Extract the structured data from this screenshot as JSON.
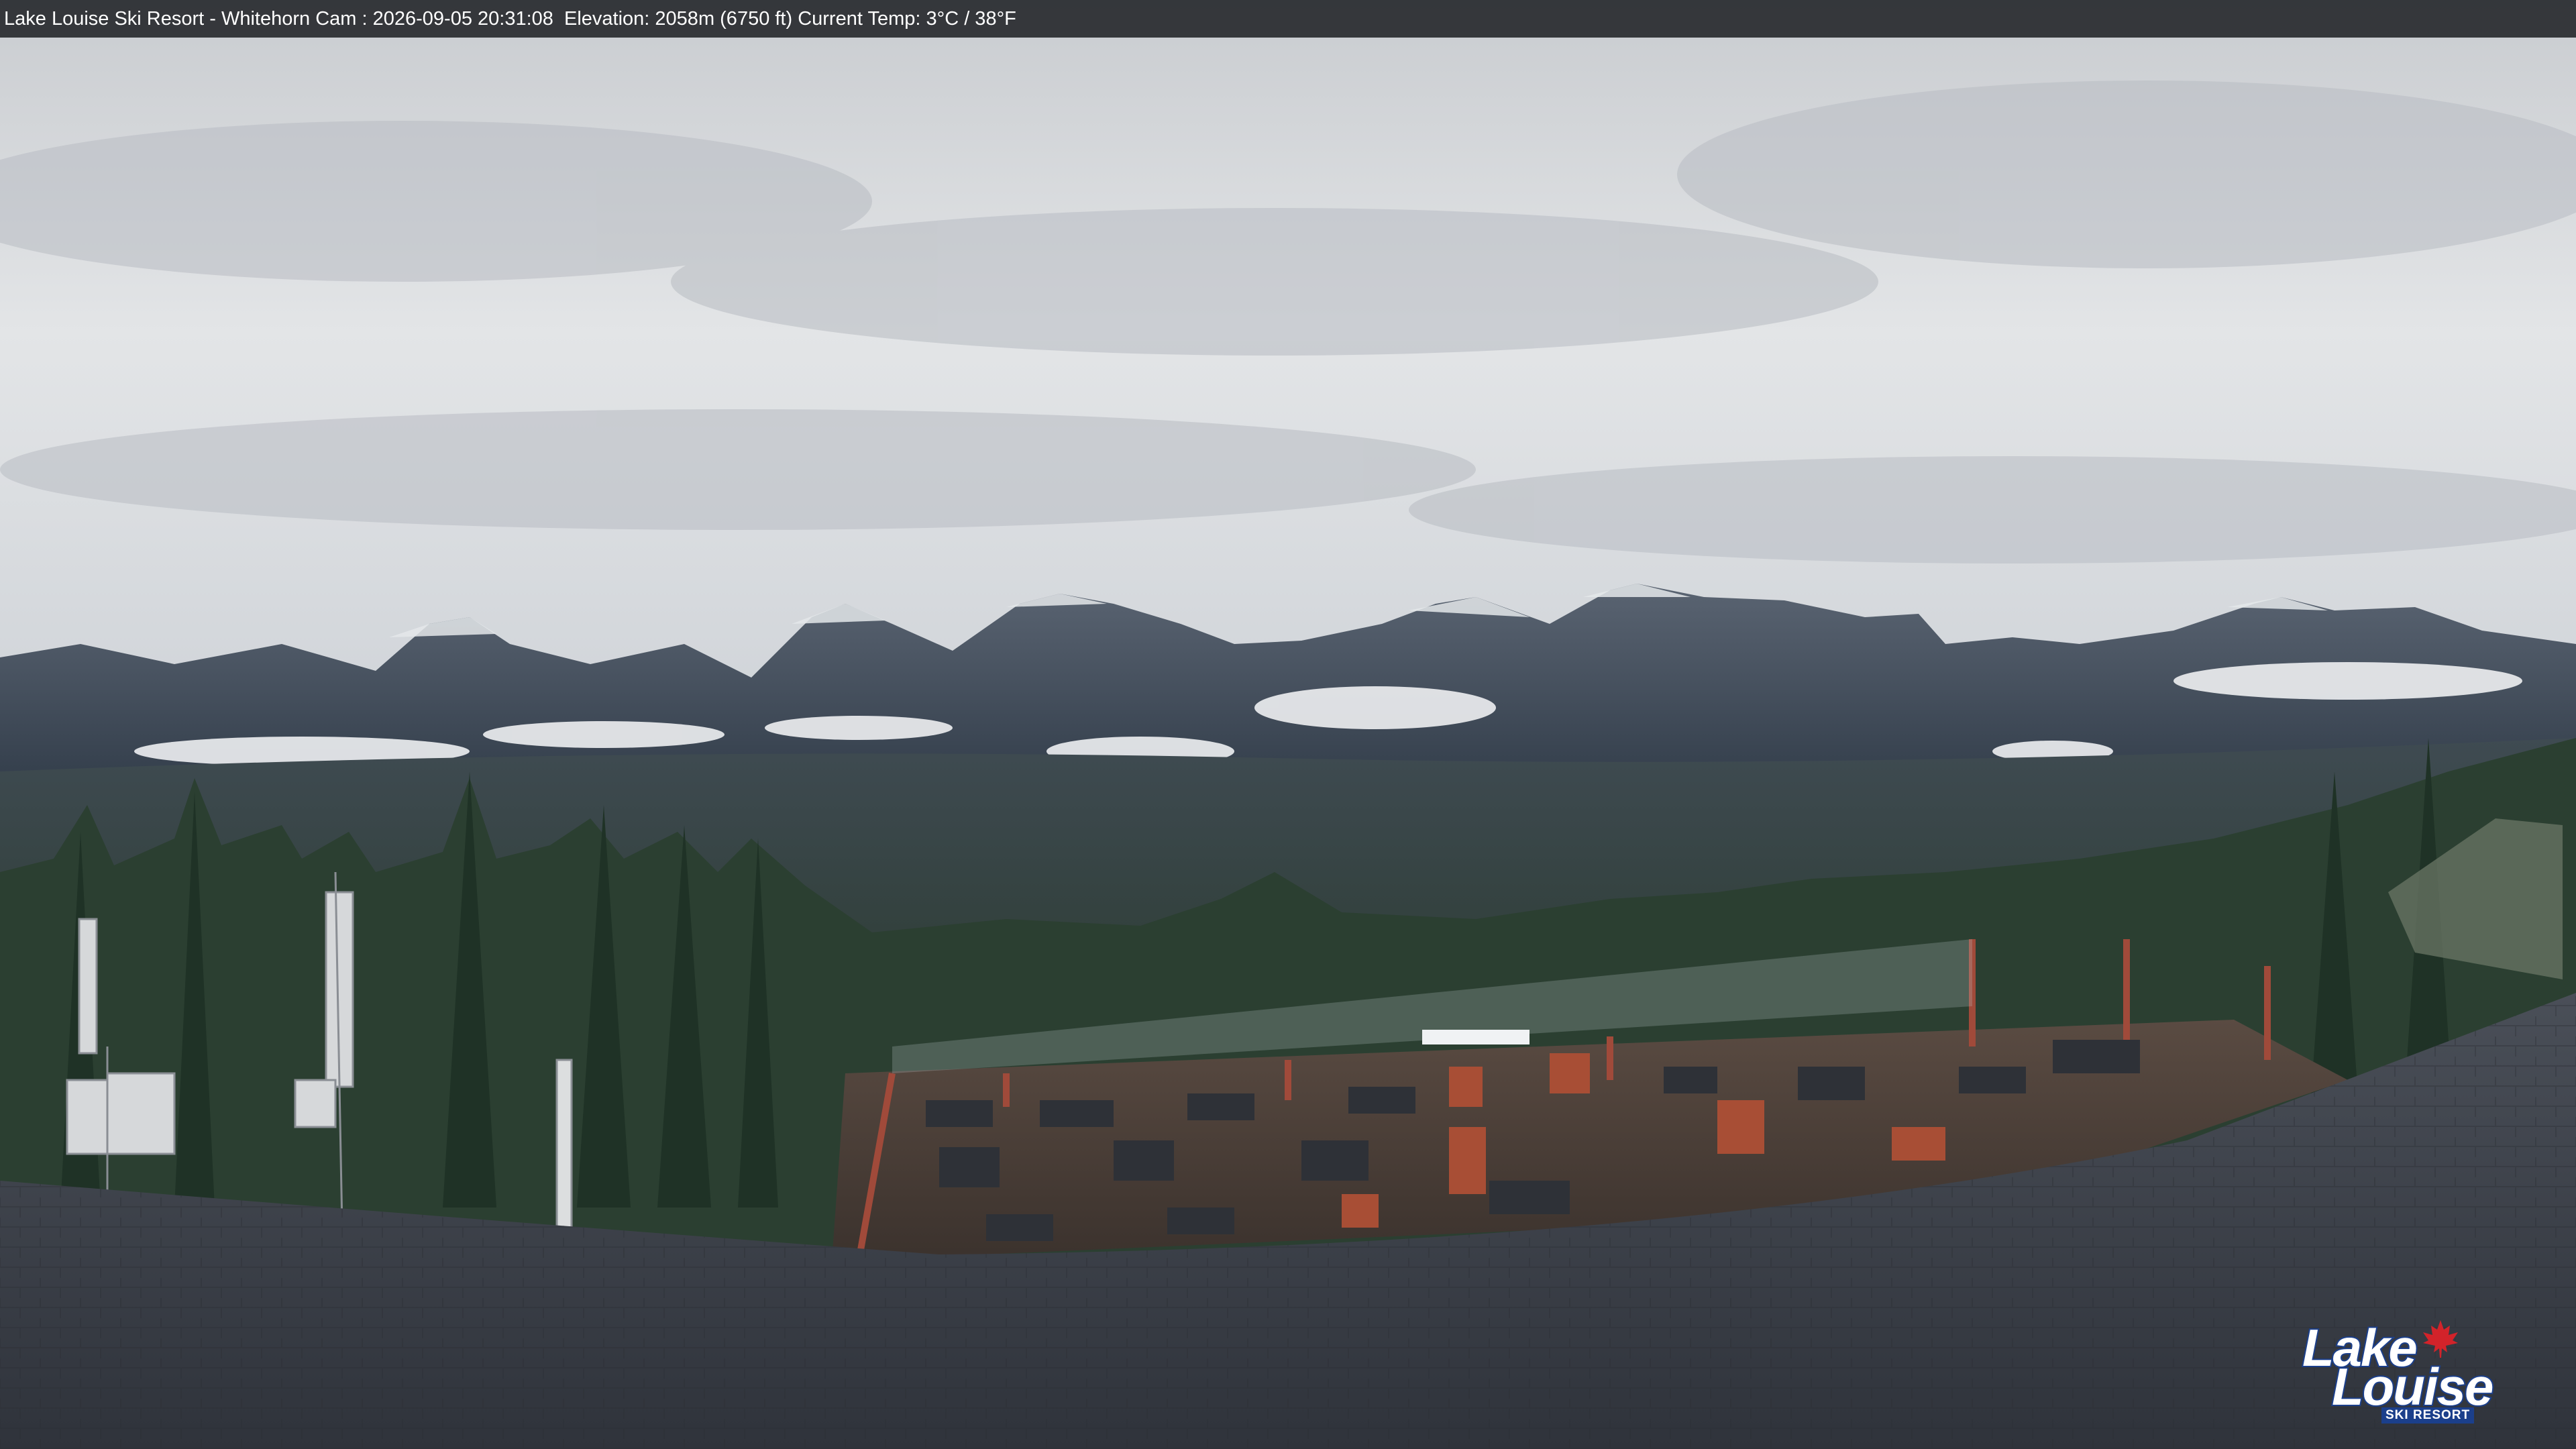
{
  "overlay": {
    "caption": "Lake Louise Ski Resort - Whitehorn Cam : 2026-09-05 20:31:08  Elevation: 2058m (6750 ft) Current Temp: 3°C / 38°F"
  },
  "logo": {
    "line1": "Lake",
    "line2": "Louise",
    "line3": "SKI RESORT",
    "icon": "maple-leaf-icon"
  },
  "colors": {
    "caption_bar": "#14161a",
    "logo_blue": "#1b3f8b",
    "maple_red": "#d2232a",
    "sky": "#d9dcdf",
    "forest": "#2f4436",
    "deck": "#4a3f38",
    "roof": "#3b4048"
  }
}
